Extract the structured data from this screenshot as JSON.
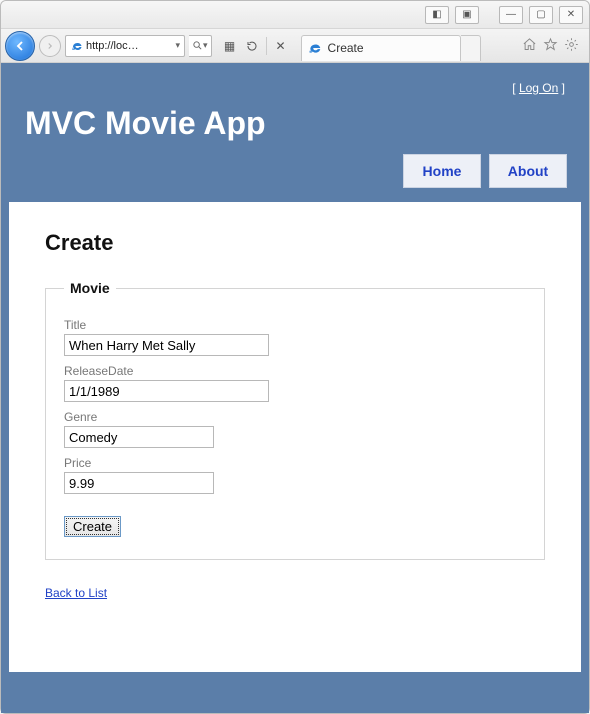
{
  "browser": {
    "address": "http://loc…",
    "tab_title": "Create"
  },
  "header": {
    "logon_open": "[ ",
    "logon_label": "Log On",
    "logon_close": " ]",
    "brand": "MVC Movie App",
    "tabs": [
      {
        "label": "Home"
      },
      {
        "label": "About"
      }
    ]
  },
  "page": {
    "heading": "Create",
    "back_link": "Back to List"
  },
  "form": {
    "legend": "Movie",
    "fields": {
      "title": {
        "label": "Title",
        "value": "When Harry Met Sally"
      },
      "releaseDate": {
        "label": "ReleaseDate",
        "value": "1/1/1989"
      },
      "genre": {
        "label": "Genre",
        "value": "Comedy"
      },
      "price": {
        "label": "Price",
        "value": "9.99"
      }
    },
    "submit_label": "Create"
  }
}
